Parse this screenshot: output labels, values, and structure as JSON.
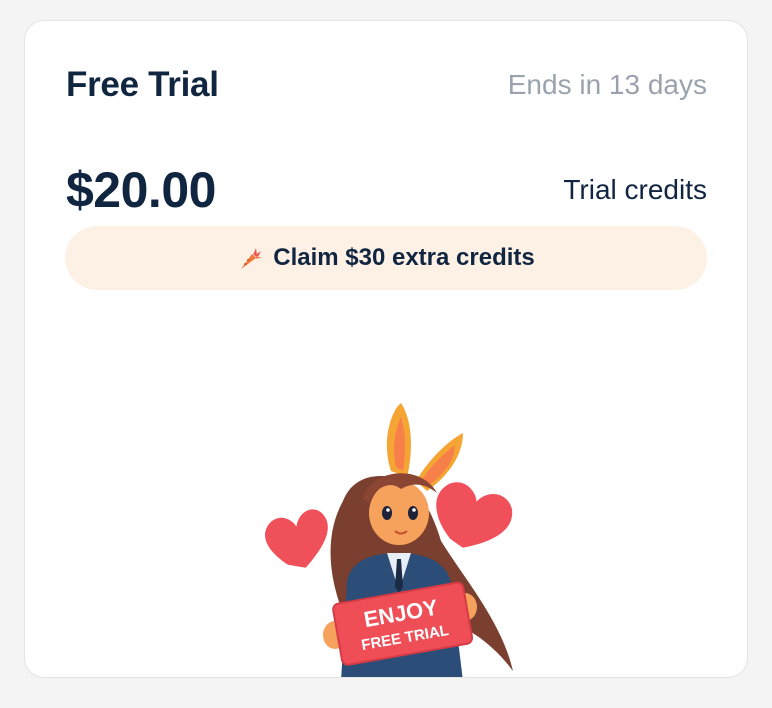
{
  "trial": {
    "title": "Free Trial",
    "ends_text": "Ends in 13 days",
    "amount": "$20.00",
    "amount_label": "Trial credits",
    "claim_label": "Claim $30 extra credits",
    "claim_icon": "carrot-icon"
  },
  "illustration": {
    "sign_line1": "ENJOY",
    "sign_line2": "FREE TRIAL",
    "icons": [
      "heart-icon",
      "bunny-girl-mascot"
    ]
  },
  "colors": {
    "text_primary": "#102540",
    "text_muted": "#9aa3ad",
    "claim_bg": "#fdf1e6",
    "accent": "#f2554f"
  }
}
